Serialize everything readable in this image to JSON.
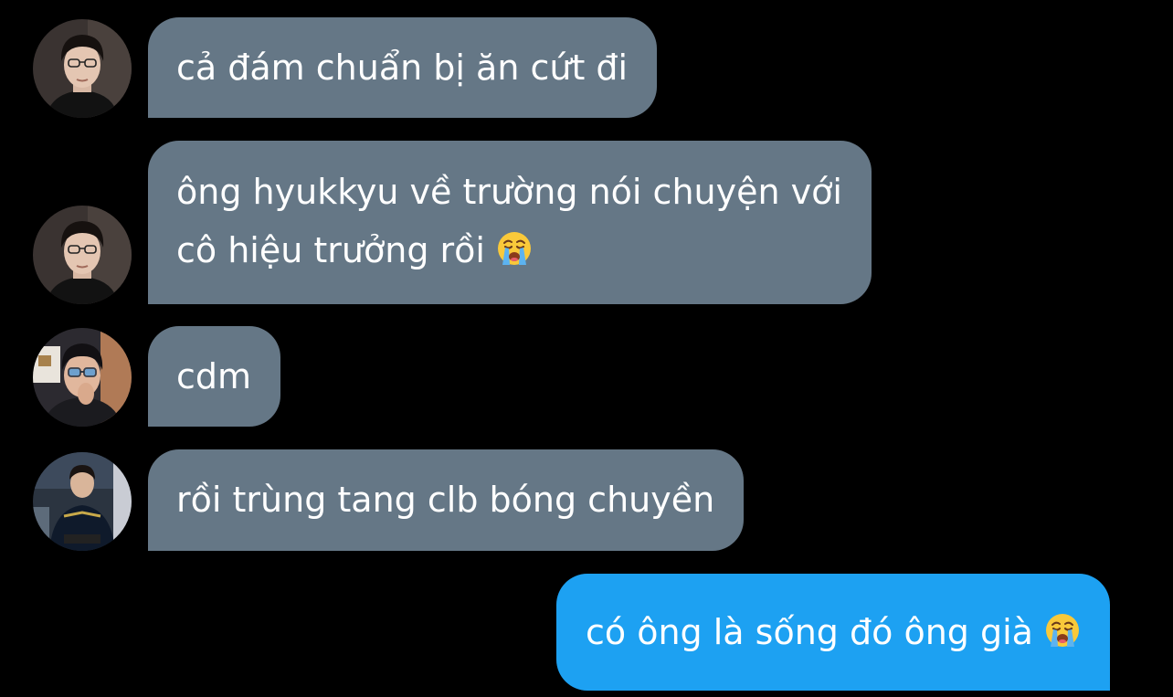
{
  "conversation": {
    "messages": [
      {
        "sender": "them",
        "avatar": "avatar-person-a",
        "lines": [
          "cả đám chuẩn bị ăn cứt đi"
        ]
      },
      {
        "sender": "them",
        "avatar": "avatar-person-a",
        "lines": [
          "ông hyukkyu về trường nói chuyện với",
          "cô hiệu trưởng rồi"
        ],
        "emoji": "loudly-crying-face-icon"
      },
      {
        "sender": "them",
        "avatar": "avatar-person-b",
        "lines": [
          "cdm"
        ]
      },
      {
        "sender": "them",
        "avatar": "avatar-person-c",
        "lines": [
          "rồi trùng tang clb bóng chuyền"
        ]
      },
      {
        "sender": "me",
        "lines": [
          "có ông là sống đó ông già"
        ],
        "emoji": "loudly-crying-face-icon"
      }
    ]
  },
  "colors": {
    "background": "#000000",
    "incoming_bubble": "#657786",
    "outgoing_bubble": "#1da1f2",
    "text": "#ffffff"
  }
}
